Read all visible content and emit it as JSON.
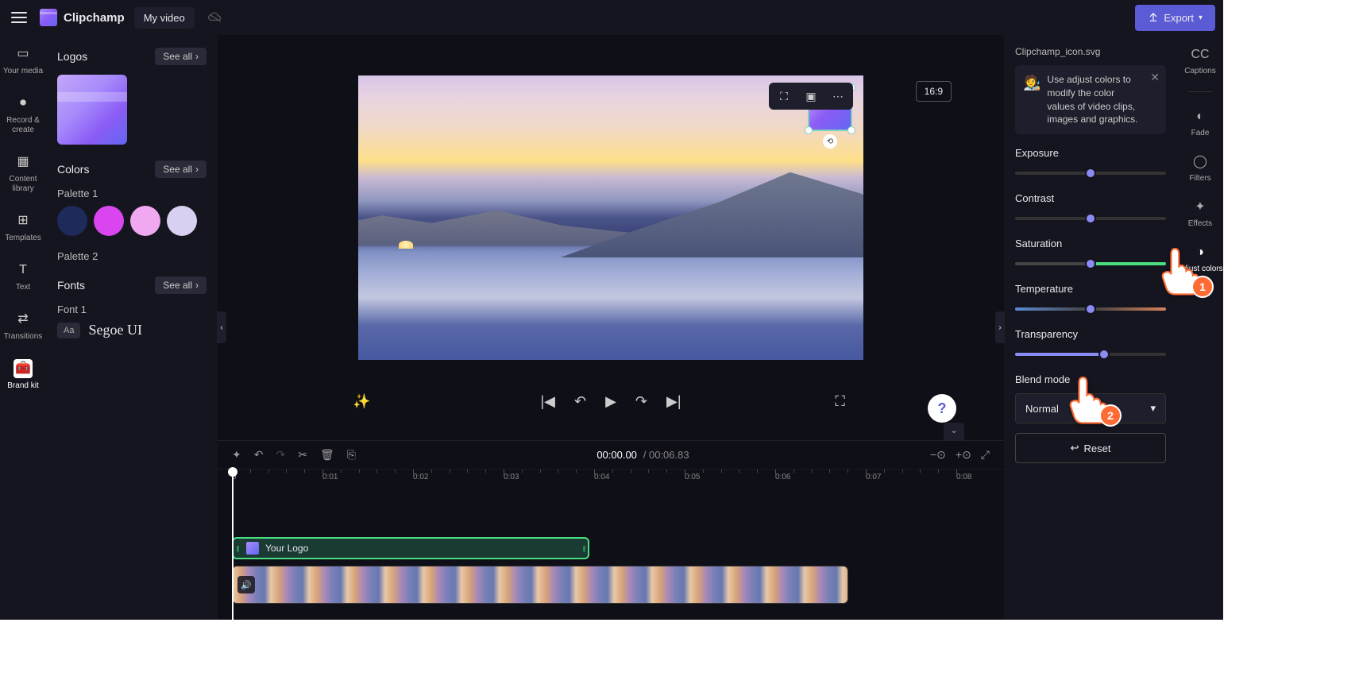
{
  "app": {
    "name": "Clipchamp",
    "project": "My video"
  },
  "export": {
    "label": "Export"
  },
  "leftnav": {
    "items": [
      {
        "label": "Your media"
      },
      {
        "label": "Record & create"
      },
      {
        "label": "Content library"
      },
      {
        "label": "Templates"
      },
      {
        "label": "Text"
      },
      {
        "label": "Transitions"
      },
      {
        "label": "Brand kit"
      }
    ]
  },
  "brandkit": {
    "logos": {
      "title": "Logos",
      "see_all": "See all"
    },
    "colors": {
      "title": "Colors",
      "see_all": "See all",
      "palette1_label": "Palette 1",
      "palette1": [
        "#1e2a5a",
        "#d946ef",
        "#f0a8f0",
        "#d8d0f0"
      ],
      "palette2_label": "Palette 2"
    },
    "fonts": {
      "title": "Fonts",
      "see_all": "See all",
      "font1_label": "Font 1",
      "font1_badge": "Aa",
      "font1_name": "Segoe UI"
    }
  },
  "preview": {
    "aspect": "16:9",
    "selected_clip": "Clipchamp_icon.svg"
  },
  "playback": {
    "current": "00:00.00",
    "duration": "00:06.83"
  },
  "timeline": {
    "ticks": [
      "0",
      "0:01",
      "0:02",
      "0:03",
      "0:04",
      "0:05",
      "0:06",
      "0:07",
      "0:08"
    ],
    "logo_clip": "Your Logo"
  },
  "props": {
    "tip": "Use adjust colors to modify the color values of video clips, images and graphics.",
    "sliders": {
      "exposure": {
        "label": "Exposure",
        "pos": 50
      },
      "contrast": {
        "label": "Contrast",
        "pos": 50
      },
      "saturation": {
        "label": "Saturation",
        "pos": 50
      },
      "temperature": {
        "label": "Temperature",
        "pos": 50
      },
      "transparency": {
        "label": "Transparency",
        "pos": 59
      }
    },
    "blend": {
      "label": "Blend mode",
      "value": "Normal"
    },
    "reset": "Reset"
  },
  "rightrail": {
    "items": [
      {
        "label": "Captions"
      },
      {
        "label": "Fade"
      },
      {
        "label": "Filters"
      },
      {
        "label": "Effects"
      },
      {
        "label": "Adjust colors"
      }
    ]
  },
  "callouts": {
    "one": "1",
    "two": "2"
  }
}
